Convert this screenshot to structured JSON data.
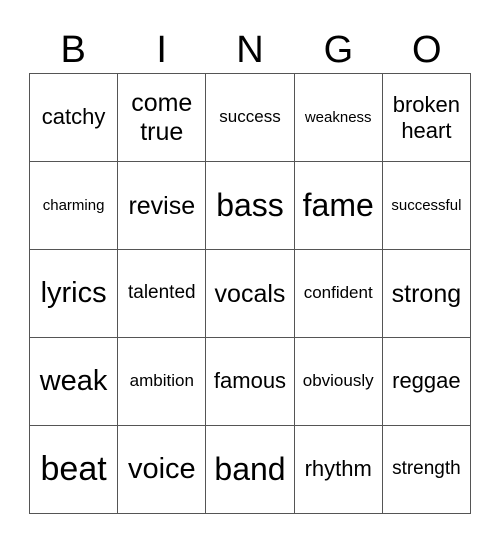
{
  "header": [
    "B",
    "I",
    "N",
    "G",
    "O"
  ],
  "cells": [
    [
      "catchy",
      "come true",
      "success",
      "weakness",
      "broken heart"
    ],
    [
      "charming",
      "revise",
      "bass",
      "fame",
      "successful"
    ],
    [
      "lyrics",
      "talented",
      "vocals",
      "confident",
      "strong"
    ],
    [
      "weak",
      "ambition",
      "famous",
      "obviously",
      "reggae"
    ],
    [
      "beat",
      "voice",
      "band",
      "rhythm",
      "strength"
    ]
  ]
}
